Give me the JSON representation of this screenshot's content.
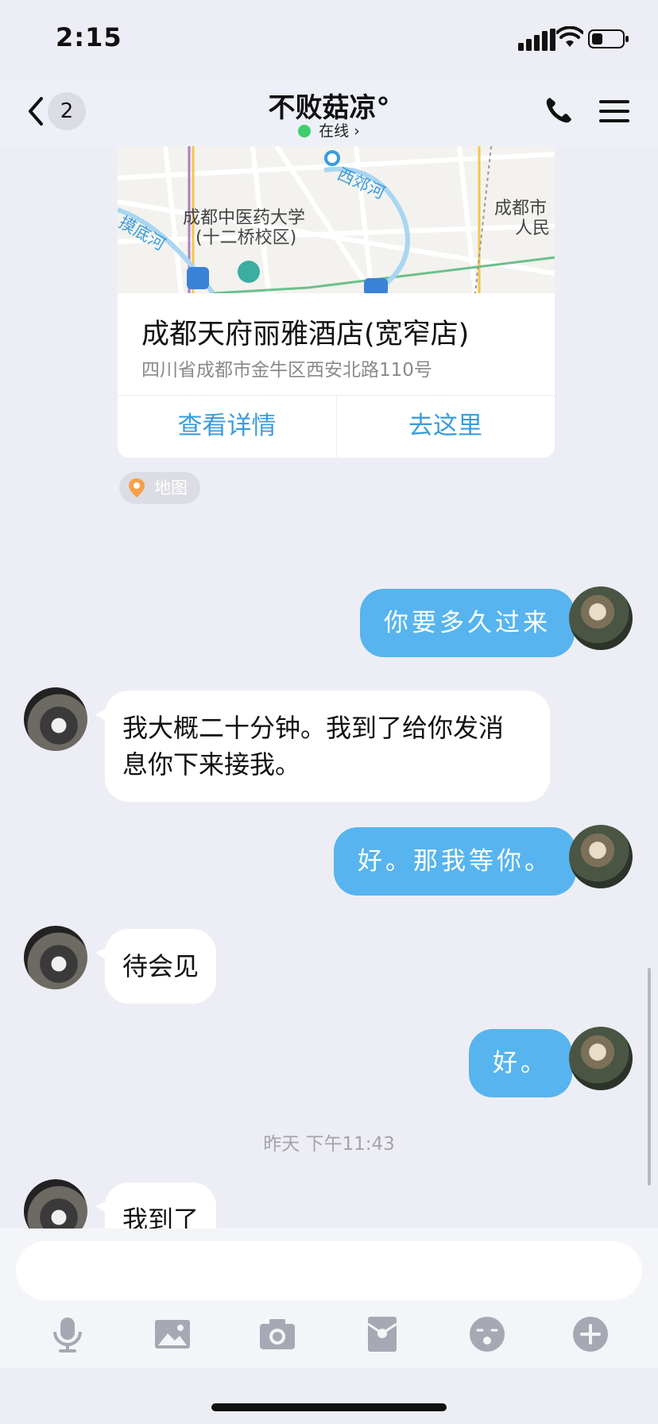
{
  "status_bar": {
    "time": "2:15"
  },
  "header": {
    "back_count": "2",
    "title": "不败菇凉°",
    "presence": "在线 ›"
  },
  "location_card": {
    "map_labels": {
      "river1": "西郊河",
      "river2": "摸底河",
      "poi1": "成都中医药大学",
      "poi2": "(十二桥校区)",
      "poi3": "成都市",
      "poi4": "人民"
    },
    "name": "成都天府丽雅酒店(宽窄店)",
    "address": "四川省成都市金牛区西安北路110号",
    "button_details": "查看详情",
    "button_go": "去这里",
    "tag_label": "地图"
  },
  "messages": [
    {
      "from": "me",
      "text": "你要多久过来"
    },
    {
      "from": "them",
      "text_line1": "我大概二十分钟。我到了给你发消",
      "text_line2": "息你下来接我。"
    },
    {
      "from": "me",
      "text": "好。那我等你。"
    },
    {
      "from": "them",
      "text": "待会见"
    },
    {
      "from": "me",
      "text": "好。"
    },
    {
      "timestamp": "昨天 下午11:43"
    },
    {
      "from": "them",
      "text": "我到了"
    }
  ],
  "input": {
    "placeholder": ""
  },
  "toolbar_icons": [
    "mic-icon",
    "image-icon",
    "camera-icon",
    "red-packet-icon",
    "emoji-icon",
    "plus-icon"
  ],
  "colors": {
    "bubble_out": "#57b4ee",
    "bubble_in": "#ffffff",
    "accent": "#3a9cdc",
    "online": "#3ecf6c"
  }
}
